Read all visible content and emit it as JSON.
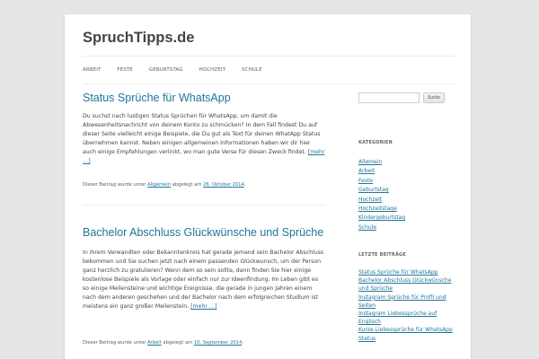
{
  "site": {
    "title": "SpruchTipps.de"
  },
  "nav": {
    "items": [
      "ARBEIT",
      "FESTE",
      "GEBURTSTAG",
      "HOCHZEIT",
      "SCHULE"
    ]
  },
  "posts": [
    {
      "title": "Status Sprüche für WhatsApp",
      "body": "Du suchst nach lustigen Status Sprüchen für WhatsApp, um damit die Abwesenheitsnachricht von deinem Konto zu schmücken? In dem Fall findest Du auf dieser Seite vielleicht einige Beispiele, die Du gut als Text für deinen WhatApp Status übernehmen kannst. Neben einigen allgemeinen Informationen haben wir dir hier auch einige Empfehlungen verlinkt, wo man gute Verse für diesen Zweck findet.",
      "more": "[mehr …]",
      "meta_prefix": "Dieser Beitrag wurde unter",
      "category": "Allgemein",
      "meta_mid": "abgelegt am",
      "date": "26. Oktober 2014",
      "meta_end": "."
    },
    {
      "title": "Bachelor Abschluss Glückwünsche und Sprüche",
      "body": "In ihrem Verwandten oder Bekanntenkreis hat gerade jemand sein Bachelor Abschluss bekommen und Sie suchen jetzt nach einem passenden Glückwunsch, um der Person ganz herzlich zu gratulieren? Wenn dem so sein sollte, dann finden Sie hier einige kostenlose Beispiele als Vorlage oder einfach nur zur Ideenfindung. Im Leben gibt es so einige Meilensteine und wichtige Ereignisse, die gerade in jungen Jahren einem nach dem anderen geschehen und der Bachelor nach dem erfolgreichen Studium ist meistens ein ganz großer Meilenstein.",
      "more": "[mehr …]",
      "meta_prefix": "Dieser Beitrag wurde unter",
      "category": "Arbeit",
      "meta_mid": "abgelegt am",
      "date": "10. September 2014",
      "meta_end": "."
    }
  ],
  "sidebar": {
    "search_button": "Suche",
    "search_value": "",
    "categories_title": "KATEGORIEN",
    "categories": [
      "Allemein",
      "Arbeit",
      "Feste",
      "Geburtstag",
      "Hochzeit",
      "Hochzeitstage",
      "Kindergeburtstag",
      "Schule"
    ],
    "recent_title": "LETZTE BEITRÄGE",
    "recent": [
      "Status Sprüche für WhatsApp",
      "Bachelor Abschluss Glückwünsche und Sprüche",
      "Instagram Sprüche für Profil und Seiten",
      "Instagram Liebessprüche auf Englisch",
      "Kurze Liebessprüche für WhatsApp Status"
    ]
  },
  "colors": {
    "link": "#21759b",
    "background": "#e6e6e6",
    "page": "#ffffff"
  }
}
